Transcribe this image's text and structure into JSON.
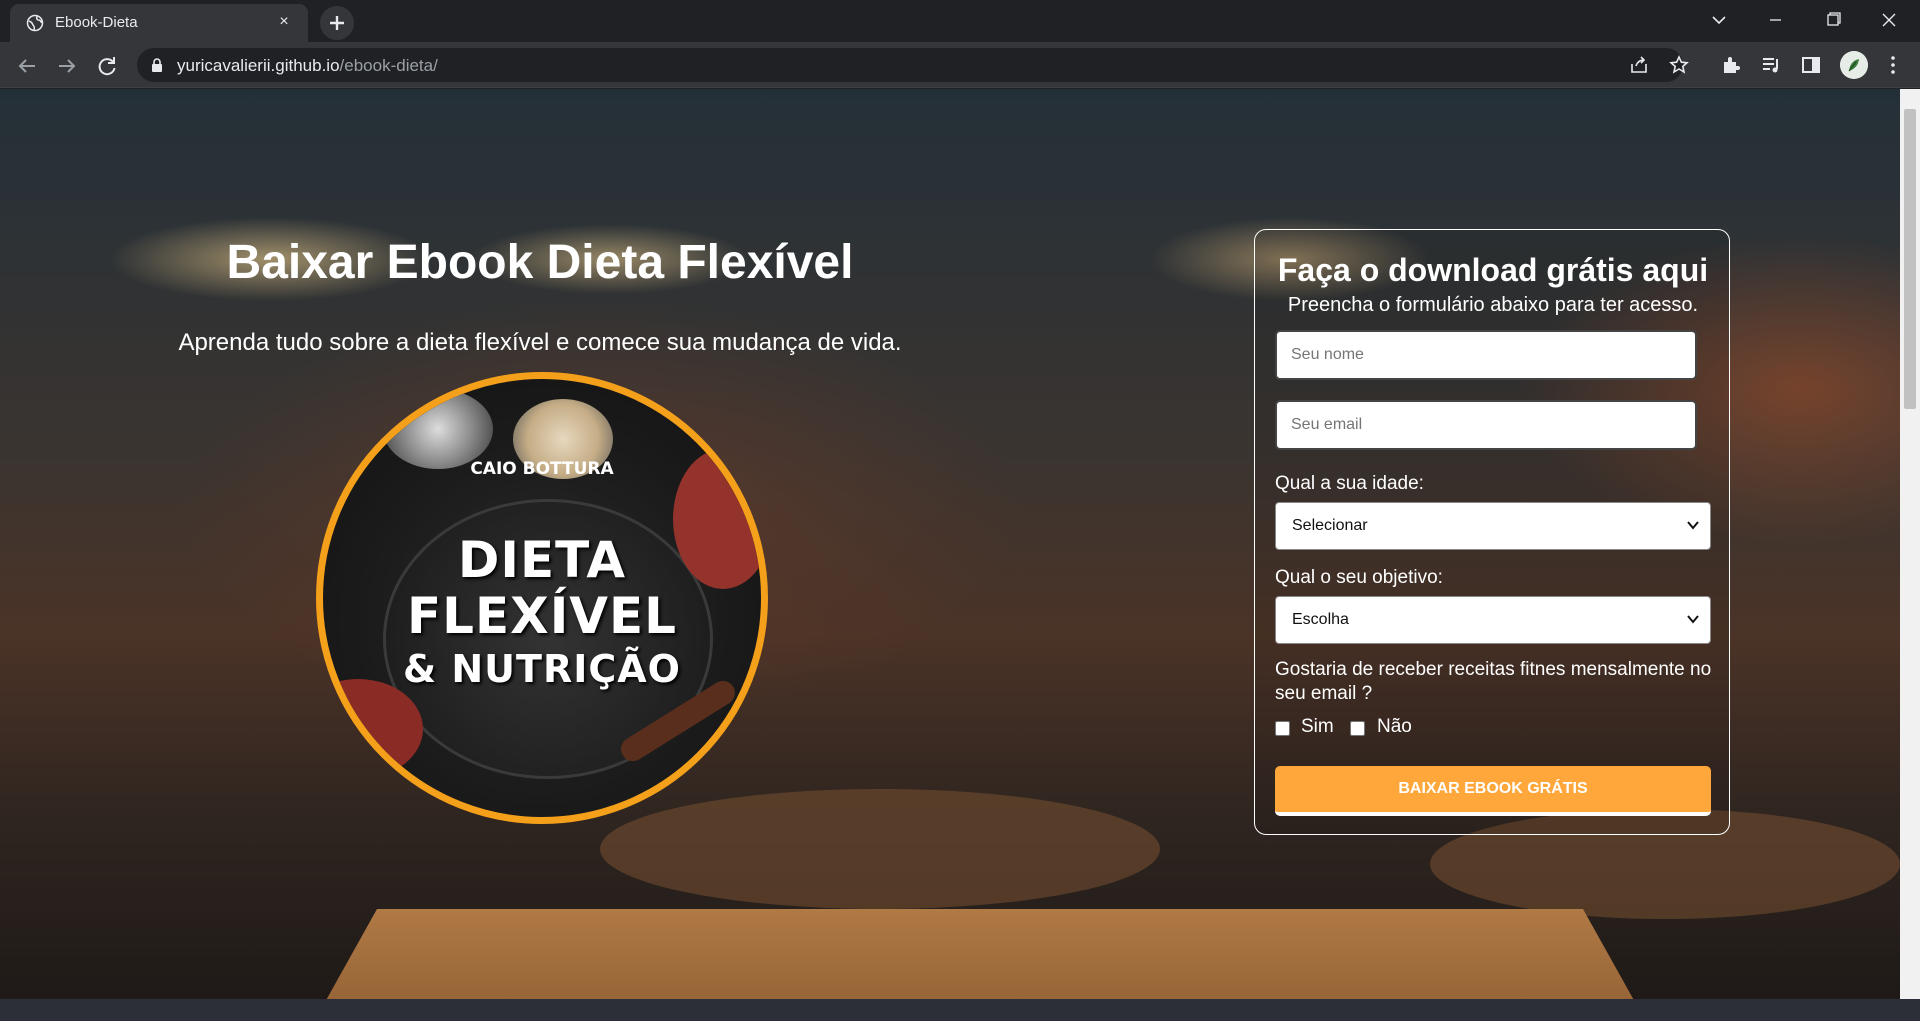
{
  "browser": {
    "tab_title": "Ebook-Dieta",
    "tab_close": "×",
    "url_host": "yuricavalierii.github.io",
    "url_path": "/ebook-dieta/"
  },
  "hero": {
    "title": "Baixar Ebook Dieta Flexível",
    "subtitle": "Aprenda tudo sobre a dieta flexível e comece sua mudança de vida."
  },
  "cover": {
    "author": "CAIO BOTTURA",
    "title_line1": "DIETA",
    "title_line2": "FLEXÍVEL",
    "title_line3": "& NUTRIÇÃO",
    "border_color": "#f5a01a"
  },
  "form": {
    "title": "Faça o download grátis aqui",
    "subtitle": "Preencha o formulário abaixo para ter acesso.",
    "name_placeholder": "Seu nome",
    "email_placeholder": "Seu email",
    "age_label": "Qual a sua idade:",
    "age_selected": "Selecionar",
    "goal_label": "Qual o seu objetivo:",
    "goal_selected": "Escolha",
    "question": "Gostaria de receber receitas fitnes mensalmente no seu email ?",
    "option_yes": "Sim",
    "option_no": "Não",
    "submit_label": "BAIXAR EBOOK GRÁTIS",
    "button_color": "#ffa73b"
  }
}
